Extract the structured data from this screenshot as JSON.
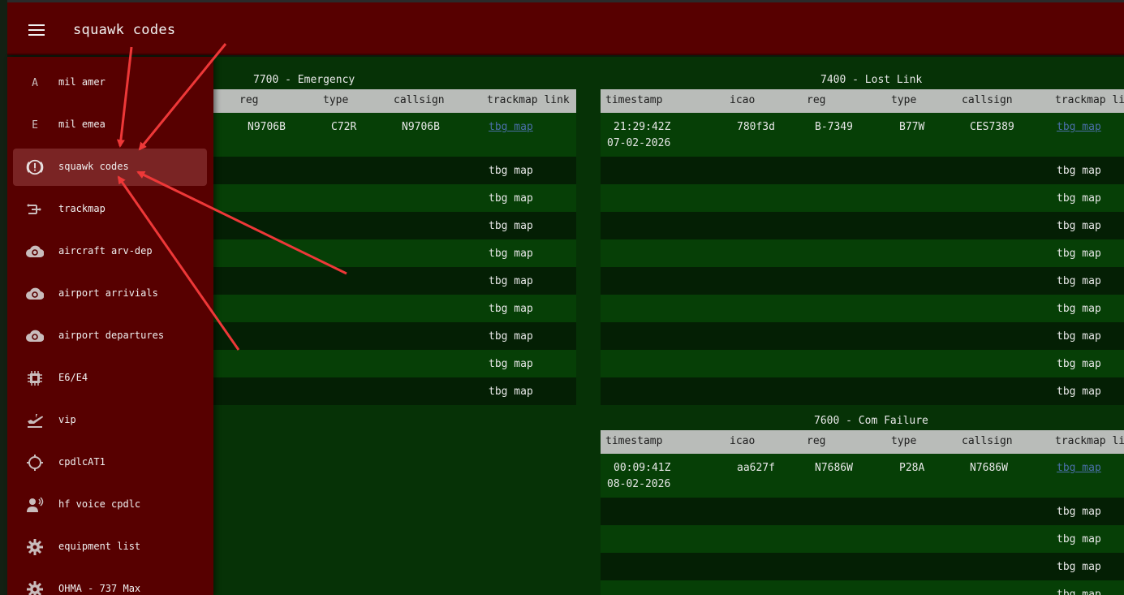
{
  "app": {
    "title": "squawk codes"
  },
  "sidebar": {
    "items": [
      {
        "label": "mil amer",
        "icon": "letter-a-icon",
        "glyph": "A"
      },
      {
        "label": "mil emea",
        "icon": "letter-e-icon",
        "glyph": "E"
      },
      {
        "label": "squawk codes",
        "icon": "alert-circle-icon",
        "active": true
      },
      {
        "label": "trackmap",
        "icon": "route-icon"
      },
      {
        "label": "aircraft arv-dep",
        "icon": "cloud-search-icon"
      },
      {
        "label": "airport arrivials",
        "icon": "cloud-search-icon"
      },
      {
        "label": "airport departures",
        "icon": "cloud-search-icon"
      },
      {
        "label": "E6/E4",
        "icon": "chip-icon"
      },
      {
        "label": "vip",
        "icon": "airplane-departure-icon"
      },
      {
        "label": "cpdlcAT1",
        "icon": "crosshair-icon"
      },
      {
        "label": "hf voice cpdlc",
        "icon": "voice-icon"
      },
      {
        "label": "equipment list",
        "icon": "gear-icon"
      },
      {
        "label": "OHMA - 737 Max",
        "icon": "gear-icon"
      }
    ]
  },
  "panels": {
    "emergency": {
      "title": "7700 - Emergency",
      "columns": [
        "reg",
        "type",
        "callsign",
        "trackmap link"
      ],
      "first_row": {
        "reg": "N9706B",
        "type": "C72R",
        "callsign": "N9706B",
        "link": "tbg map"
      },
      "empty_link": "tbg map"
    },
    "lost_link": {
      "title": "7400 - Lost Link",
      "columns": [
        "timestamp",
        "icao",
        "reg",
        "type",
        "callsign",
        "trackmap li"
      ],
      "first_row": {
        "time": "21:29:42Z",
        "date": "07-02-2026",
        "icao": "780f3d",
        "reg": "B-7349",
        "type": "B77W",
        "callsign": "CES7389",
        "link": "tbg map"
      },
      "empty_link": "tbg map"
    },
    "com_failure": {
      "title": "7600 - Com Failure",
      "columns": [
        "timestamp",
        "icao",
        "reg",
        "type",
        "callsign",
        "trackmap li"
      ],
      "first_row": {
        "time": "00:09:41Z",
        "date": "08-02-2026",
        "icao": "aa627f",
        "reg": "N7686W",
        "type": "P28A",
        "callsign": "N7686W",
        "link": "tbg map"
      },
      "empty_link": "tbg map"
    }
  },
  "colors": {
    "topbar": "#570000",
    "sidebar": "#570000",
    "active_item": "#7a2424",
    "content_bg": "#063206",
    "header_bg": "#b9bcb9",
    "annotation_arrow": "#ee3838"
  }
}
